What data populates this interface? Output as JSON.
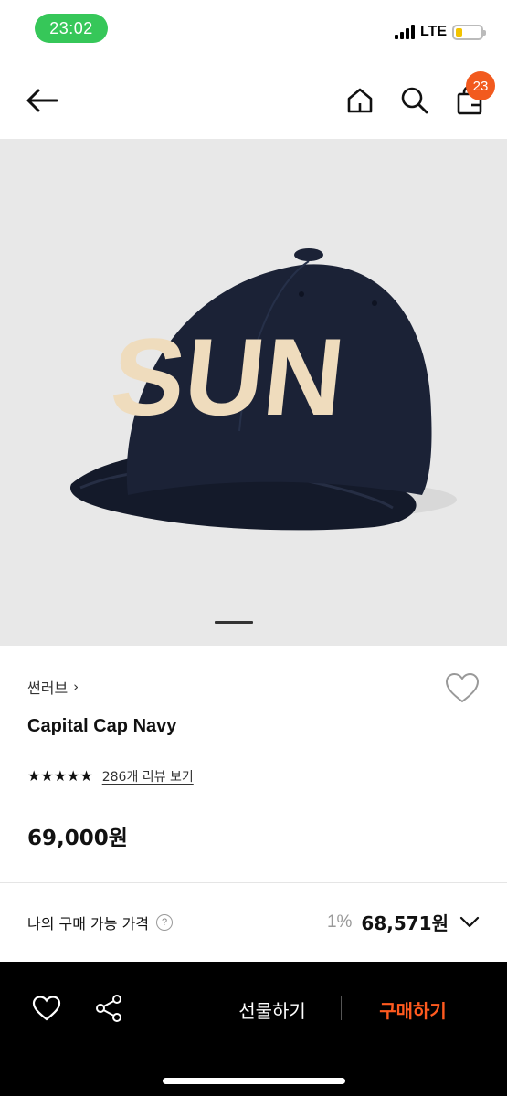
{
  "status_bar": {
    "time": "23:02",
    "network": "LTE",
    "battery_level": 0.28,
    "colors": {
      "time_pill": "#36c759",
      "battery": "#f2c300"
    }
  },
  "header": {
    "icons": [
      "back-arrow-icon",
      "home-icon",
      "search-icon",
      "cart-icon"
    ],
    "cart_badge": "23",
    "badge_color": "#f25a1e"
  },
  "hero": {
    "cap_text": "SUN",
    "image_position": "1 of N"
  },
  "product": {
    "brand": "썬러브",
    "name": "Capital Cap Navy",
    "rating_stars": 5,
    "stars": "★★★★★",
    "review_link": "286개 리뷰 보기",
    "price": "69,000원"
  },
  "my_price": {
    "label": "나의 구매 가능 가격",
    "help": "?",
    "discount": "1%",
    "value": "68,571원"
  },
  "bottom_bar": {
    "gift_label": "선물하기",
    "buy_label": "구매하기",
    "buy_color": "#ff5a1f"
  }
}
